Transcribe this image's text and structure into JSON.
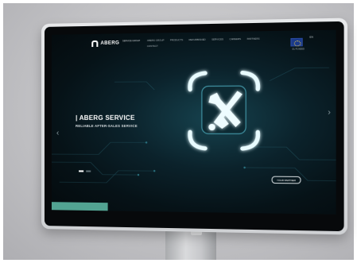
{
  "site": {
    "logo_text": "ABERG",
    "sublogo_text": "SERVICE GROUP",
    "nav_items": [
      "ABERG GROUP",
      "PRODUCTS",
      "REFURBISHED",
      "SERVICES",
      "CAREERS",
      "PARTNERS"
    ],
    "nav_contact": "CONTACT",
    "lang": "EN",
    "eu_caption": "EU FUNDED",
    "hero_title": "| ABERG SERVICE",
    "hero_subtitle": "RELIABLE AFTER-SALES SERVICE",
    "cta_label": "YOUR PARTNER",
    "slide_count": 2,
    "active_slide": 0
  },
  "icons": {
    "prev": "chevron-left-icon",
    "next": "chevron-right-icon",
    "hero": "wrench-screwdriver-icon",
    "flag": "eu-flag-icon"
  },
  "colors": {
    "screen_bg": "#061217",
    "accent_teal": "#52a392",
    "glow": "#bff7ff",
    "monitor_body": "#d9dadc"
  }
}
